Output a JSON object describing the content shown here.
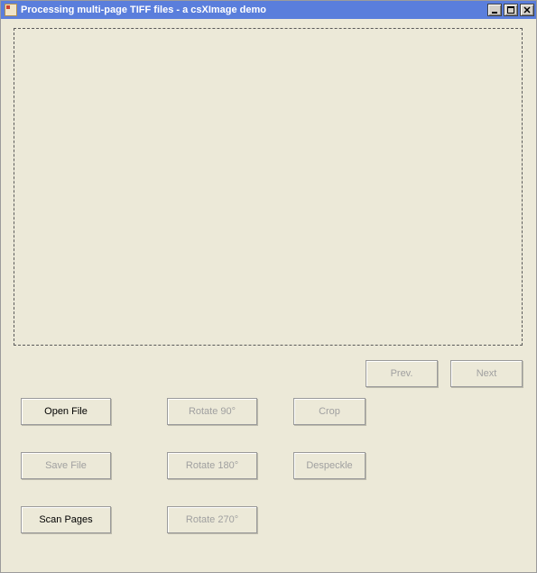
{
  "window": {
    "title": "Processing multi-page TIFF files - a csXImage demo"
  },
  "nav": {
    "prev": "Prev.",
    "next": "Next"
  },
  "buttons": {
    "open_file": "Open File",
    "save_file": "Save File",
    "scan_pages": "Scan Pages",
    "rotate_90": "Rotate 90°",
    "rotate_180": "Rotate 180°",
    "rotate_270": "Rotate 270°",
    "crop": "Crop",
    "despeckle": "Despeckle"
  }
}
